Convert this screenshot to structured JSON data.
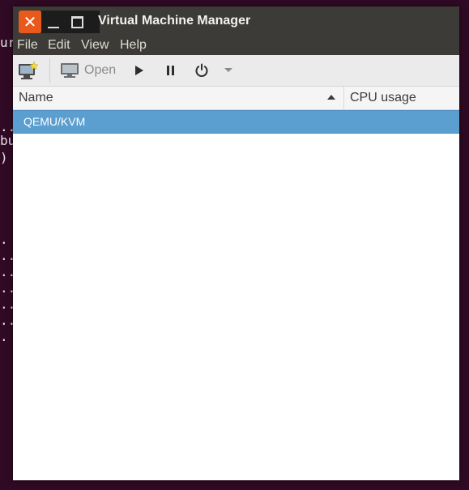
{
  "background_terminal": {
    "fragments": [
      "ur",
      "..",
      "bu",
      ")",
      ".",
      "..",
      "..",
      "..",
      "..",
      "..",
      "..",
      "."
    ]
  },
  "window": {
    "title": "Virtual Machine Manager",
    "close_glyph": "✕"
  },
  "menu": {
    "file": "File",
    "edit": "Edit",
    "view": "View",
    "help": "Help"
  },
  "toolbar": {
    "open_label": "Open"
  },
  "columns": {
    "name": "Name",
    "cpu": "CPU usage"
  },
  "connections": [
    {
      "name": "QEMU/KVM",
      "selected": true
    }
  ],
  "colors": {
    "accent_close": "#e9591c",
    "titlebar": "#3c3b37",
    "selection": "#5b9fd0",
    "desktop": "#300a24"
  }
}
